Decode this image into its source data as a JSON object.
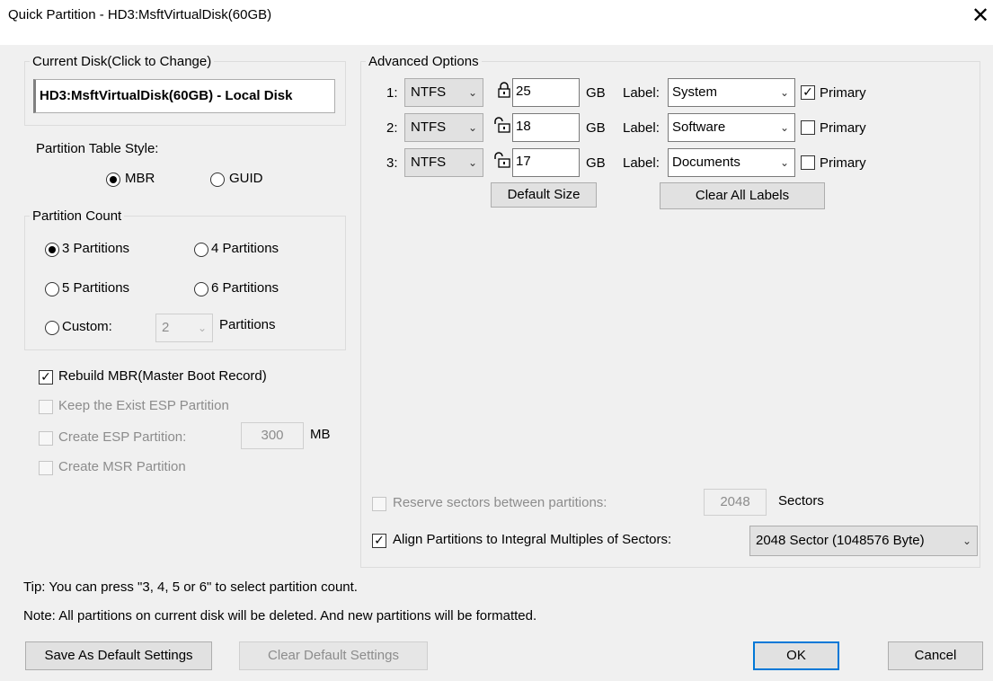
{
  "window": {
    "title": "Quick Partition - HD3:MsftVirtualDisk(60GB)",
    "close_glyph": "✕"
  },
  "current_disk": {
    "legend": "Current Disk(Click to Change)",
    "value": "HD3:MsftVirtualDisk(60GB) - Local Disk"
  },
  "partition_table": {
    "label": "Partition Table Style:",
    "options": [
      "MBR",
      "GUID"
    ],
    "selected": "MBR"
  },
  "partition_count": {
    "legend": "Partition Count",
    "options": [
      "3 Partitions",
      "4 Partitions",
      "5 Partitions",
      "6 Partitions"
    ],
    "selected": "3 Partitions",
    "custom_label": "Custom:",
    "custom_value": "2",
    "custom_suffix": "Partitions"
  },
  "options": {
    "rebuild_mbr": {
      "label": "Rebuild MBR(Master Boot Record)",
      "checked": true
    },
    "keep_esp": {
      "label": "Keep the Exist ESP Partition",
      "checked": false
    },
    "create_esp": {
      "label": "Create ESP Partition:",
      "checked": false,
      "size": "300",
      "unit": "MB"
    },
    "create_msr": {
      "label": "Create MSR Partition",
      "checked": false
    }
  },
  "advanced": {
    "legend": "Advanced Options",
    "size_unit": "GB",
    "label_prefix": "Label:",
    "primary_label": "Primary",
    "rows": [
      {
        "index": "1:",
        "fs": "NTFS",
        "lock": "locked-icon",
        "size": "25",
        "label": "System",
        "primary": true
      },
      {
        "index": "2:",
        "fs": "NTFS",
        "lock": "unlocked-icon",
        "size": "18",
        "label": "Software",
        "primary": false
      },
      {
        "index": "3:",
        "fs": "NTFS",
        "lock": "unlocked-icon",
        "size": "17",
        "label": "Documents",
        "primary": false
      }
    ],
    "default_size_button": "Default Size",
    "clear_labels_button": "Clear All Labels",
    "reserve": {
      "label": "Reserve sectors between partitions:",
      "checked": false,
      "value": "2048",
      "unit": "Sectors"
    },
    "align": {
      "label": "Align Partitions to Integral Multiples of Sectors:",
      "checked": true,
      "value": "2048 Sector (1048576 Byte)"
    }
  },
  "tip": "Tip:  You can press \"3, 4, 5 or 6\" to select partition count.",
  "note": "Note: All partitions on current disk will be deleted. And new partitions will be formatted.",
  "buttons": {
    "save_default": "Save As Default Settings",
    "clear_default": "Clear Default Settings",
    "ok": "OK",
    "cancel": "Cancel"
  },
  "colors": {
    "focus_accent": "#0078d7",
    "dialog_bg": "#f0f0f0"
  }
}
